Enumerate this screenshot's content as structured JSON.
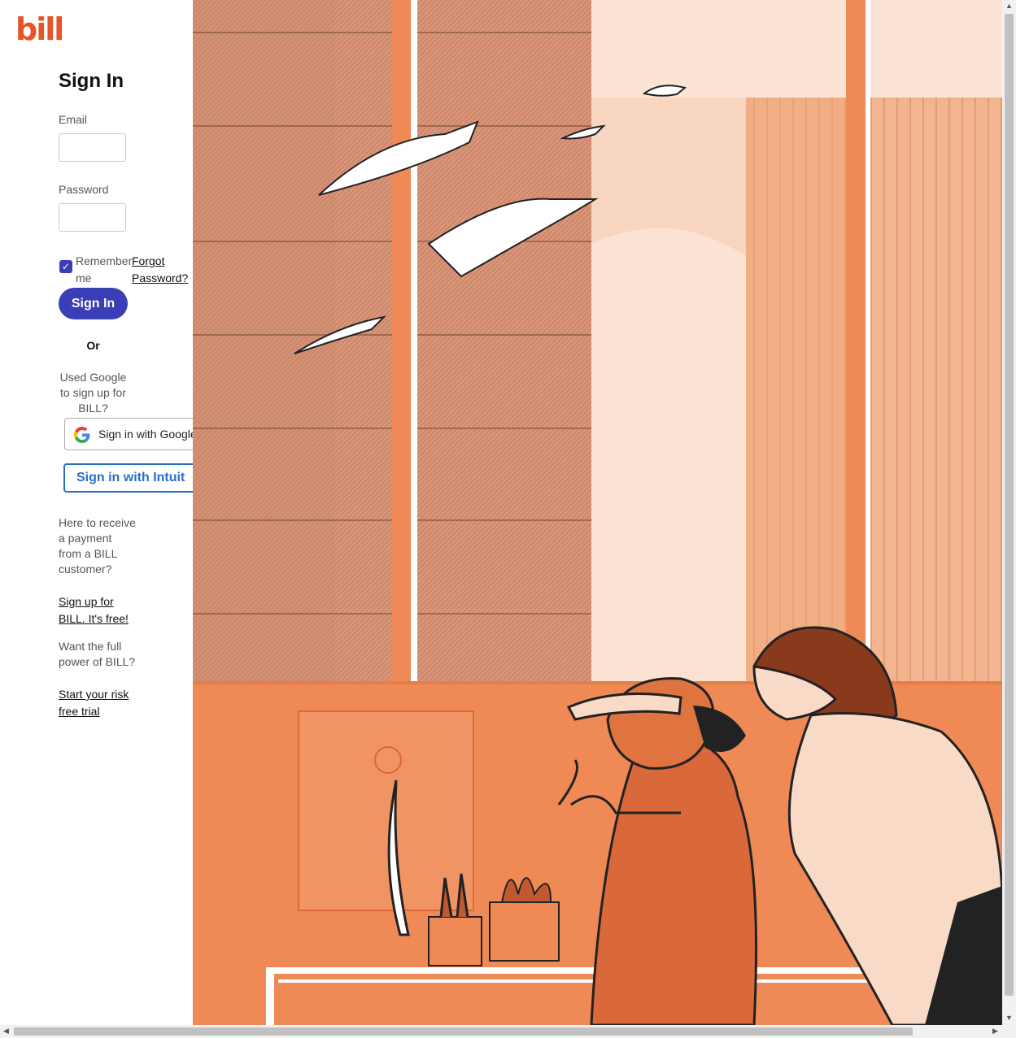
{
  "brand": {
    "logo_text": "bill",
    "color": "#e8542a"
  },
  "form": {
    "title": "Sign In",
    "email_label": "Email",
    "email_value": "",
    "password_label": "Password",
    "password_value": "",
    "remember_label": "Remember me",
    "remember_checked": true,
    "forgot_label": "Forgot Password?",
    "signin_label": "Sign In",
    "or_label": "Or",
    "google_prompt": "Used Google to sign up for BILL?",
    "google_button": "Sign in with Google",
    "intuit_button": "Sign in with Intuit"
  },
  "payment": {
    "text": "Here to receive a payment from a BILL customer?",
    "link": "Sign up for BILL. It's free!"
  },
  "trial": {
    "text": "Want the full power of BILL?",
    "link": "Start your risk free trial"
  },
  "colors": {
    "primary": "#3b3fb6",
    "intuit": "#2a6fc4",
    "illustration": "#ef8a56"
  }
}
